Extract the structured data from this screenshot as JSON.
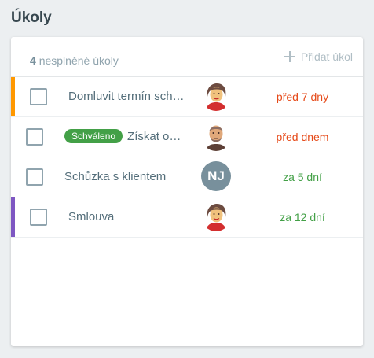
{
  "page": {
    "title": "Úkoly"
  },
  "header": {
    "count": "4",
    "count_label": "nesplněné úkoly",
    "add_label": "Přidat úkol"
  },
  "tasks": [
    {
      "title": "Domluvit termín sch…",
      "badge": null,
      "assignee": "woman-avatar",
      "due": "před 7 dny",
      "due_color": "#e64a19",
      "stripe_color": "#ff9800"
    },
    {
      "title": "Získat o…",
      "badge": "Schváleno",
      "assignee": "man-avatar",
      "due": "před dnem",
      "due_color": "#e64a19",
      "stripe_color": null
    },
    {
      "title": "Schůzka s klientem",
      "badge": null,
      "assignee_initials": "NJ",
      "due": "za 5 dní",
      "due_color": "#43a047",
      "stripe_color": null
    },
    {
      "title": "Smlouva",
      "badge": null,
      "assignee": "woman-avatar",
      "due": "za 12 dní",
      "due_color": "#43a047",
      "stripe_color": "#7e57c2"
    }
  ],
  "colors": {
    "overdue": "#e64a19",
    "upcoming": "#43a047",
    "badge_approved": "#43a047",
    "stripe_orange": "#ff9800",
    "stripe_purple": "#7e57c2"
  }
}
